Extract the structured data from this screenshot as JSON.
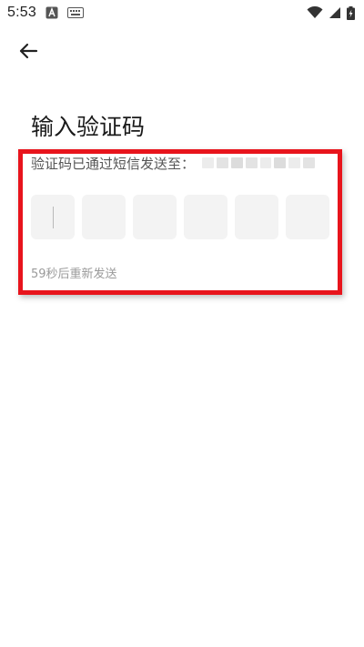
{
  "status_bar": {
    "time": "5:53",
    "icons": [
      "a-icon",
      "keyboard-icon",
      "wifi-icon",
      "signal-icon",
      "battery-charging-icon"
    ]
  },
  "header": {
    "back_icon": "arrow-left-icon"
  },
  "main": {
    "title": "输入验证码",
    "sent_label": "验证码已通过短信发送至：",
    "otp_box_count": 6,
    "resend_text": "59秒后重新发送"
  },
  "colors": {
    "annotation_red": "#e8141c",
    "otp_box_bg": "#f3f3f3",
    "hint_text": "#9a9a9a"
  }
}
